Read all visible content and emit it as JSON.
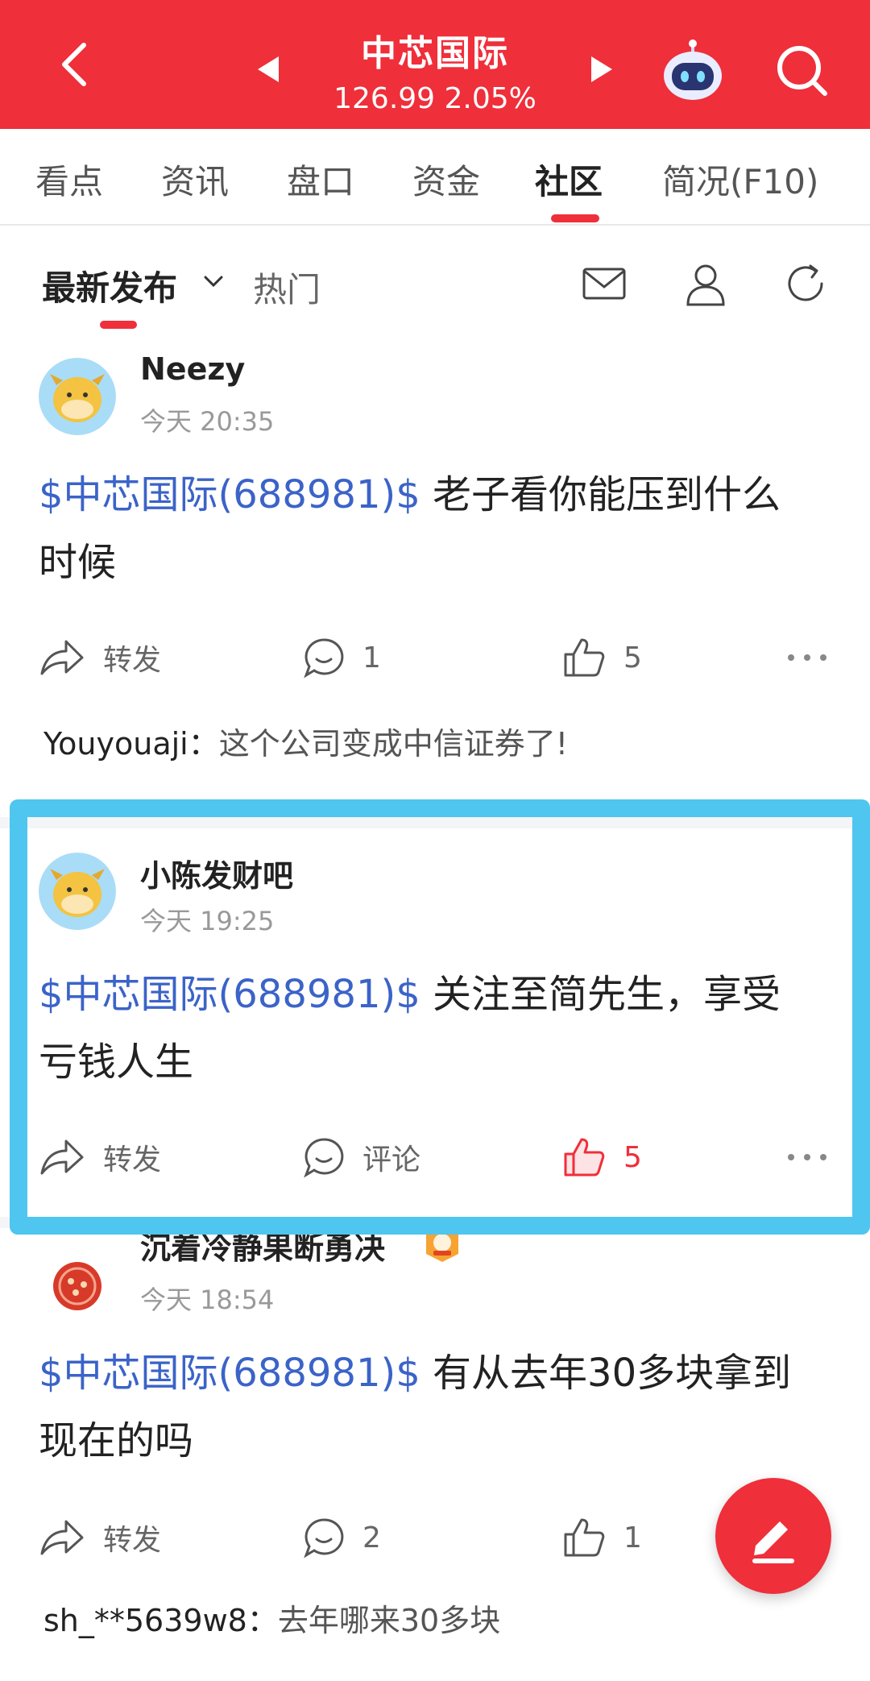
{
  "header": {
    "stock_name": "中芯国际",
    "quote": "126.99 2.05%",
    "accent": "#ef2f3a"
  },
  "tabs": [
    {
      "label": "看点"
    },
    {
      "label": "资讯"
    },
    {
      "label": "盘口"
    },
    {
      "label": "资金"
    },
    {
      "label": "社区",
      "active": true
    },
    {
      "label": "简况(F10)"
    }
  ],
  "subbar": {
    "latest": "最新发布",
    "hot": "热门"
  },
  "posts": [
    {
      "user": "Neezy",
      "time": "今天 20:35",
      "stock_tag": "$中芯国际(688981)$",
      "text": " 老子看你能压到什么时候",
      "forward": "转发",
      "comments": "1",
      "likes": "5",
      "comment_preview": {
        "user": "Youyouaji：",
        "text": "这个公司变成中信证券了!"
      }
    },
    {
      "user": "小陈发财吧",
      "time": "今天 19:25",
      "stock_tag": "$中芯国际(688981)$",
      "text": " 关注至简先生，享受亏钱人生",
      "forward": "转发",
      "comments": "评论",
      "likes": "5",
      "liked": true
    },
    {
      "user": "沉着冷静果断勇决",
      "time": "今天 18:54",
      "stock_tag": "$中芯国际(688981)$",
      "text": " 有从去年30多块拿到现在的吗",
      "forward": "转发",
      "comments": "2",
      "likes": "1",
      "comment_preview": {
        "user": "sh_**5639w8：",
        "text": "去年哪来30多块"
      }
    }
  ],
  "icons": {
    "back": "chevron-left-icon",
    "prev": "triangle-left-icon",
    "next": "triangle-right-icon",
    "robot": "robot-assistant-icon",
    "search": "search-icon",
    "mail": "mail-icon",
    "user": "user-icon",
    "refresh": "refresh-icon",
    "compose": "edit-icon"
  },
  "highlight_color": "#4ec6ef"
}
